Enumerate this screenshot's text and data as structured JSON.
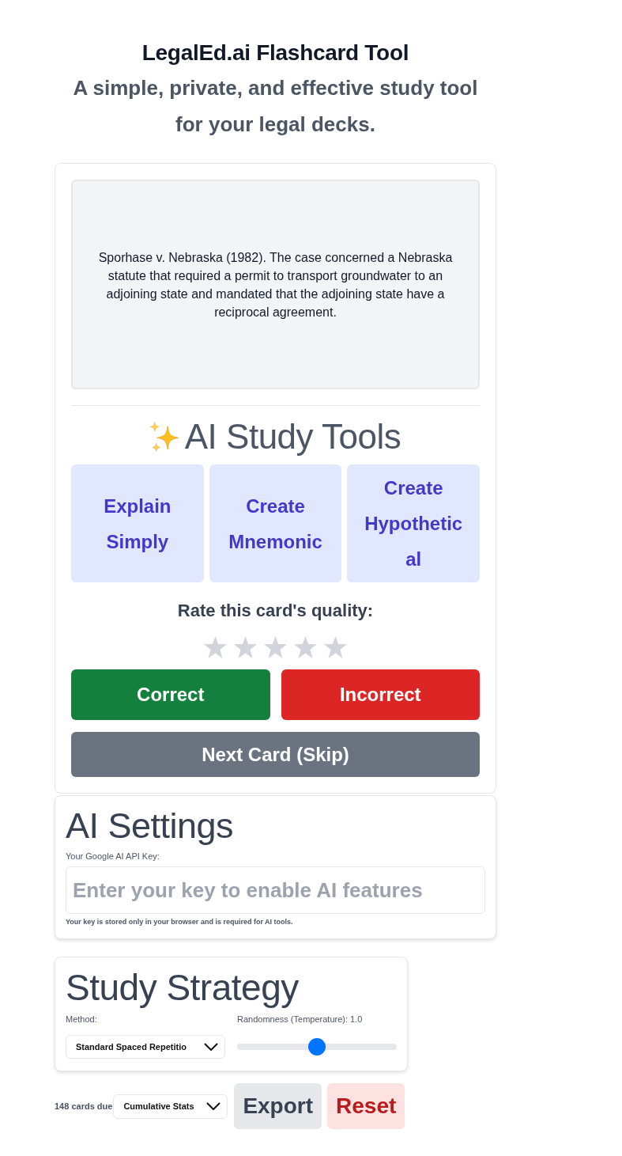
{
  "header": {
    "title": "LegalEd.ai Flashcard Tool",
    "subtitle": "A simple, private, and effective study tool for your legal decks."
  },
  "flashcard": {
    "text": "Sporhase v. Nebraska (1982). The case concerned a Nebraska statute that required a permit to transport groundwater to an adjoining state and mandated that the adjoining state have a reciprocal agreement."
  },
  "ai_tools": {
    "title": "AI Study Tools",
    "buttons": [
      "Explain Simply",
      "Create Mnemonic",
      "Create Hypothetical"
    ]
  },
  "rating": {
    "label": "Rate this card's quality:",
    "stars": 0
  },
  "answer_buttons": [
    {
      "label": "Correct",
      "kind": "correct"
    },
    {
      "label": "Incorrect",
      "kind": "incorrect"
    }
  ],
  "skip_button": "Next Card (Skip)",
  "ai_settings": {
    "title": "AI Settings",
    "key_label": "Your Google AI API Key:",
    "key_field": {
      "placeholder": "Enter your key to enable AI features"
    },
    "hint": "Your key is stored only in your browser and is required for AI tools."
  },
  "study_strategy": {
    "title": "Study Strategy",
    "method_label": "Method:",
    "method_value": "Standard Spaced Repetitio",
    "temperature": {
      "label": "Randomness (Temperature): 1.0",
      "level": 0.5
    }
  },
  "footer": {
    "due_count": "148 cards due",
    "stats_select": "Cumulative Stats",
    "buttons": [
      {
        "label": "Export",
        "kind": "export"
      },
      {
        "label": "Reset",
        "kind": "reset"
      }
    ]
  }
}
